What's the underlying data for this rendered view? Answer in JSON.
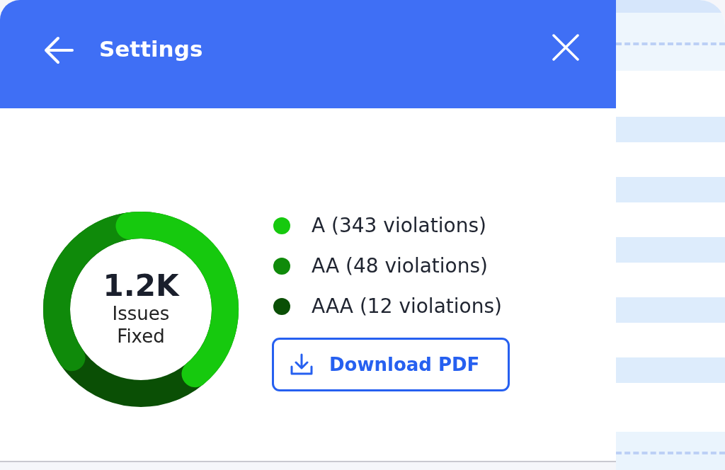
{
  "header": {
    "title": "Settings"
  },
  "summary": {
    "value": "1.2K",
    "label_line_1": "Issues",
    "label_line_2": "Fixed"
  },
  "legend": [
    {
      "label": "A (343 violations)",
      "color": "#16c90e"
    },
    {
      "label": "AA (48 violations)",
      "color": "#0f8a0a"
    },
    {
      "label": "AAA (12 violations)",
      "color": "#0a4f05"
    }
  ],
  "download_button": {
    "label": "Download PDF"
  }
}
